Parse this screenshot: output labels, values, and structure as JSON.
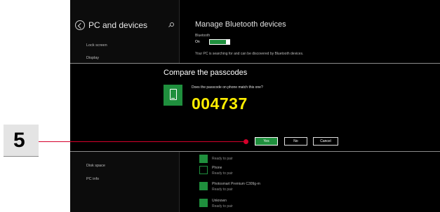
{
  "settings": {
    "title": "PC and devices",
    "sidebar_items": [
      "Lock screen",
      "Display",
      "Disk space",
      "PC info"
    ]
  },
  "bluetooth": {
    "title": "Manage Bluetooth devices",
    "label": "Bluetooth",
    "state": "On",
    "description": "Your PC is searching for and can be discovered by Bluetooth devices."
  },
  "dialog": {
    "title": "Compare the passcodes",
    "question": "Does the passcode on phone match this one?",
    "passcode": "004737",
    "yes_label": "Yes",
    "no_label": "No",
    "cancel_label": "Cancel"
  },
  "devices": [
    {
      "name": "",
      "status": "Ready to pair",
      "icon": "device-icon"
    },
    {
      "name": "Phone",
      "status": "Ready to pair",
      "icon": "phone-icon"
    },
    {
      "name": "Photosmart Premium C309g-m",
      "status": "Ready to pair",
      "icon": "printer-icon"
    },
    {
      "name": "Unknown",
      "status": "Ready to pair",
      "icon": "unknown-device-icon"
    }
  ],
  "annotation": {
    "step_number": "5",
    "pointer_color": "#d5002b"
  },
  "colors": {
    "accent": "#1f8f3d",
    "passcode": "#ffee00",
    "background": "#000000"
  }
}
